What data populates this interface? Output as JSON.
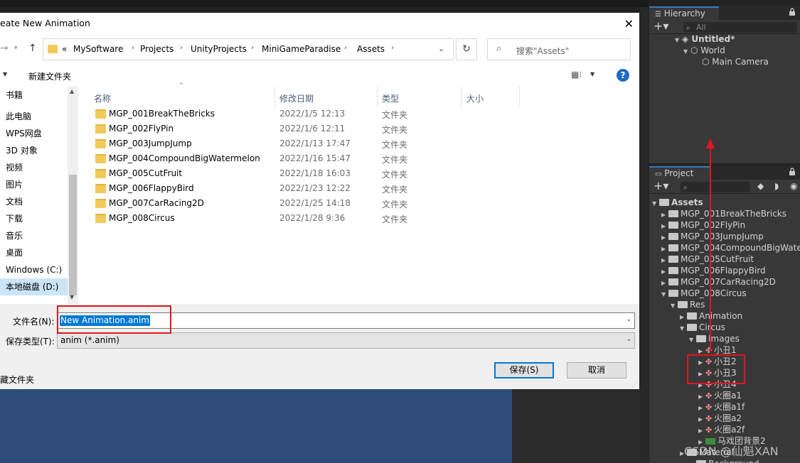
{
  "dialog": {
    "title": "eate New Animation",
    "close": "✕",
    "breadcrumbs": [
      "«",
      "MySoftware",
      "Projects",
      "UnityProjects",
      "MiniGameParadise",
      "Assets"
    ],
    "search_placeholder": "搜索\"Assets\"",
    "new_folder": "新建文件夹",
    "help": "?",
    "nav_items": [
      "书籍",
      "此电脑",
      "WPS网盘",
      "3D 对象",
      "视频",
      "图片",
      "文档",
      "下载",
      "音乐",
      "桌面",
      "Windows (C:)",
      "本地磁盘 (D:)"
    ],
    "selected_nav": "本地磁盘 (D:)",
    "columns": [
      "名称",
      "修改日期",
      "类型",
      "大小"
    ],
    "files": [
      {
        "name": "MGP_001BreakTheBricks",
        "date": "2022/1/5 12:13",
        "type": "文件夹"
      },
      {
        "name": "MGP_002FlyPin",
        "date": "2022/1/6 12:11",
        "type": "文件夹"
      },
      {
        "name": "MGP_003JumpJump",
        "date": "2022/1/13 17:47",
        "type": "文件夹"
      },
      {
        "name": "MGP_004CompoundBigWatermelon",
        "date": "2022/1/16 15:47",
        "type": "文件夹"
      },
      {
        "name": "MGP_005CutFruit",
        "date": "2022/1/18 16:03",
        "type": "文件夹"
      },
      {
        "name": "MGP_006FlappyBird",
        "date": "2022/1/23 12:22",
        "type": "文件夹"
      },
      {
        "name": "MGP_007CarRacing2D",
        "date": "2022/1/25 14:18",
        "type": "文件夹"
      },
      {
        "name": "MGP_008Circus",
        "date": "2022/1/28 9:36",
        "type": "文件夹"
      }
    ],
    "filename_label": "文件名(N):",
    "filename_value": "New Animation.anim",
    "filetype_label": "保存类型(T):",
    "filetype_value": "anim (*.anim)",
    "hide_folders": "藏文件夹",
    "save": "保存(S)",
    "cancel": "取消"
  },
  "hierarchy": {
    "tab": "Hierarchy",
    "search_placeholder": "All",
    "items": [
      "Untitled*",
      "World",
      "Main Camera"
    ]
  },
  "project": {
    "tab": "Project",
    "tree": [
      "Assets",
      "MGP_001BreakTheBricks",
      "MGP_002FlyPin",
      "MGP_003JumpJump",
      "MGP_004CompoundBigWate",
      "MGP_005CutFruit",
      "MGP_006FlappyBird",
      "MGP_007CarRacing2D",
      "MGP_008Circus",
      "Res",
      "Animation",
      "Circus",
      "Images",
      "小丑1",
      "小丑2",
      "小丑3",
      "小丑4",
      "火圈a1",
      "火圈a1f",
      "火圈a2",
      "火圈a2f",
      "马戏团背景2",
      "Material",
      "Background"
    ]
  },
  "watermark": "CSDN @仙魁XAN",
  "colors": {
    "highlight": "#e0161e",
    "unity_panel": "#383838",
    "selection": "#0078d7"
  }
}
